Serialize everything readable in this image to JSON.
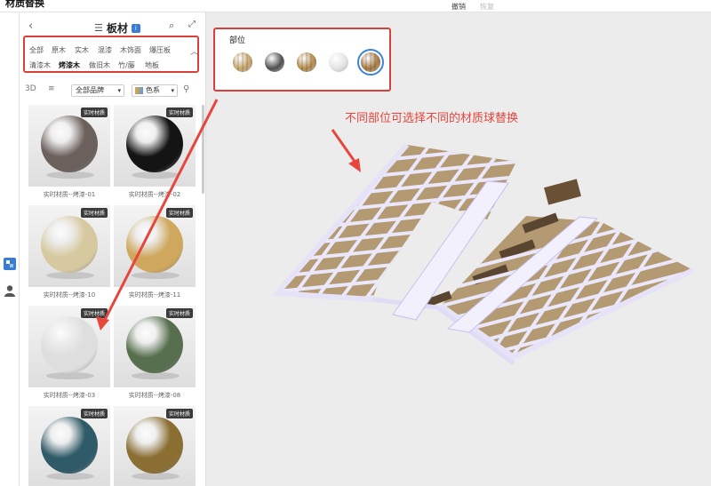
{
  "app": {
    "title": "材质替换",
    "undo_label": "撤销",
    "redo_label": "恢复"
  },
  "panel": {
    "title": "板材",
    "categories_row1": [
      "全部",
      "原木",
      "实木",
      "混漆",
      "木饰面",
      "爆压板"
    ],
    "categories_row2": [
      "清漆木",
      "烤漆木",
      "做旧木",
      "竹/藤",
      "地板"
    ],
    "active_category": "烤漆木",
    "view_3d": "3D",
    "brand_select": "全部品牌",
    "color_select": "色系",
    "tag_label": "实时材质",
    "materials": [
      {
        "name": "实时材质--烤漆-01",
        "color": "#6c605c"
      },
      {
        "name": "实时材质--烤漆-02",
        "color": "#141414"
      },
      {
        "name": "实时材质--烤漆-10",
        "color": "#d6c9a0"
      },
      {
        "name": "实时材质--烤漆-11",
        "color": "#cfa85e"
      },
      {
        "name": "实时材质--烤漆-03",
        "color": "#dedede"
      },
      {
        "name": "实时材质--烤漆-08",
        "color": "#576f4e"
      },
      {
        "name": "",
        "color": "#2f5a68"
      },
      {
        "name": "",
        "color": "#8a6e32"
      }
    ]
  },
  "parts": {
    "title": "部位",
    "items": [
      {
        "icon": "light-wood-material-icon",
        "color": "#c9a66b"
      },
      {
        "icon": "dark-stone-material-icon",
        "color": "#4f4f4f"
      },
      {
        "icon": "oak-wood-material-icon",
        "color": "#b68c4c"
      },
      {
        "icon": "white-material-icon",
        "color": "#e3e3e3"
      },
      {
        "icon": "wood-stripe-material-icon",
        "color": "#a97b45"
      }
    ],
    "selected_index": 4
  },
  "annotation": "不同部位可选择不同的材质球替换",
  "colors": {
    "highlight": "#d8403a",
    "arrow": "#e8453c",
    "frame": "#ece8fb",
    "frame_edge": "#c6c0ee",
    "panel_wood": "#b39a72"
  }
}
